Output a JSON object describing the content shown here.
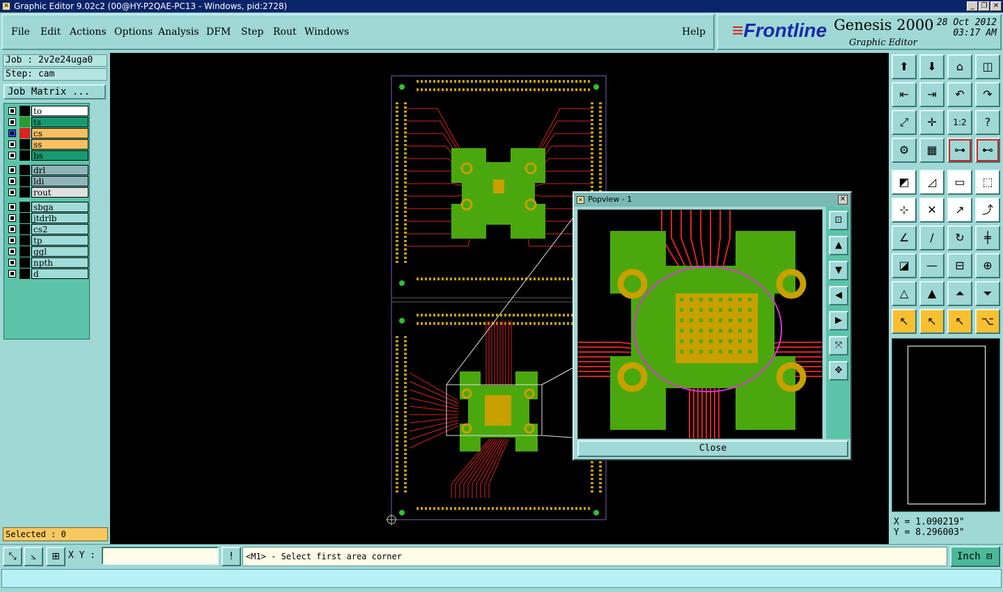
{
  "window": {
    "title": "Graphic Editor 9.02c2 (00@HY-P2QAE-PC13 - Windows, pid:2728)"
  },
  "menu": {
    "items": [
      "File",
      "Edit",
      "Actions",
      "Options",
      "Analysis",
      "DFM",
      "Step",
      "Rout",
      "Windows"
    ],
    "help": "Help"
  },
  "brand": {
    "logo": "Frontline",
    "product": "Genesis 2000",
    "subtitle": "Graphic Editor",
    "date": "28 Oct 2012",
    "time": "03:17 AM"
  },
  "job": {
    "job_label": "Job : 2v2e24uga0",
    "step_label": "Step: cam",
    "matrix_button": "Job Matrix ..."
  },
  "layers": [
    {
      "name": "to",
      "color": "#ffffff",
      "swatch": "#000000"
    },
    {
      "name": "ts",
      "color": "#1a9a70",
      "swatch": "#2a9a30"
    },
    {
      "name": "cs",
      "color": "#f8c060",
      "swatch": "#e02020",
      "active": true
    },
    {
      "name": "ss",
      "color": "#f8c060",
      "swatch": "#000000"
    },
    {
      "name": "bs",
      "color": "#1a9a70",
      "swatch": "#000000"
    },
    {
      "name": "drl",
      "color": "#90b4b8",
      "swatch": "#000000"
    },
    {
      "name": "ldi",
      "color": "#90b4b8",
      "swatch": "#000000"
    },
    {
      "name": "rout",
      "color": "#e0e0e0",
      "swatch": "#000000"
    },
    {
      "name": "sbga",
      "color": "#a0dcd8",
      "swatch": "#000000"
    },
    {
      "name": "jtdrlb",
      "color": "#a0dcd8",
      "swatch": "#000000"
    },
    {
      "name": "cs2",
      "color": "#a0dcd8",
      "swatch": "#000000"
    },
    {
      "name": "tp",
      "color": "#a0dcd8",
      "swatch": "#000000"
    },
    {
      "name": "ggl",
      "color": "#a0dcd8",
      "swatch": "#000000"
    },
    {
      "name": "npth",
      "color": "#a0dcd8",
      "swatch": "#000000"
    },
    {
      "name": "d",
      "color": "#a0dcd8",
      "swatch": "#000000"
    }
  ],
  "selected": "Selected : 0",
  "popview": {
    "title": "Popview - 1",
    "close_button": "Close"
  },
  "coords": {
    "x": "X = 1.090219\"",
    "y": "Y = 8.296003\""
  },
  "bottom": {
    "xy_label": "X Y :",
    "xy_value": "",
    "prompt": "<M1> - Select first area corner",
    "unit": "Inch"
  },
  "status": "",
  "colors": {
    "panel": "#9fd8d5",
    "copper": "#e02020",
    "pad_green": "#4aa80e",
    "gold": "#c8a000",
    "magenta": "#e030e0"
  }
}
